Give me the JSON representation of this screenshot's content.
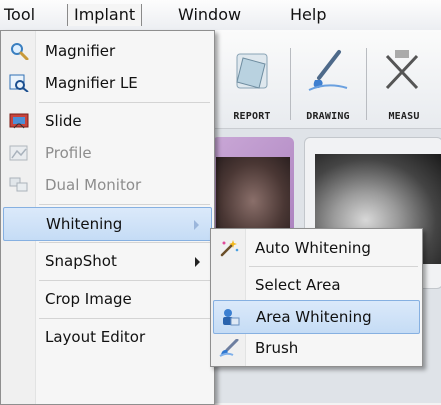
{
  "menubar": {
    "items": [
      "Tool",
      "Implant",
      "Window",
      "Help"
    ]
  },
  "toolbar": {
    "buttons": [
      "REPORT",
      "DRAWING",
      "MEASU"
    ]
  },
  "tool_menu": {
    "items": [
      {
        "label": "Magnifier",
        "icon": "magnifier-icon"
      },
      {
        "label": "Magnifier LE",
        "icon": "magnifier-le-icon"
      },
      {
        "label": "Slide",
        "icon": "slide-icon"
      },
      {
        "label": "Profile",
        "icon": "profile-icon",
        "disabled": true
      },
      {
        "label": "Dual Monitor",
        "icon": "dual-monitor-icon",
        "disabled": true
      },
      {
        "label": "Whitening",
        "submenu": true,
        "highlighted": true
      },
      {
        "label": "SnapShot",
        "submenu": true
      },
      {
        "label": "Crop Image"
      },
      {
        "label": "Layout Editor"
      }
    ]
  },
  "whitening_submenu": {
    "items": [
      {
        "label": "Auto Whitening",
        "icon": "magic-wand-icon"
      },
      {
        "label": "Select Area"
      },
      {
        "label": "Area Whitening",
        "icon": "area-whitening-icon",
        "highlighted": true
      },
      {
        "label": "Brush",
        "icon": "brush-icon"
      }
    ]
  },
  "colors": {
    "highlight": "#c5dcf5",
    "highlight_border": "#86b0e1",
    "disabled_text": "#8d8d8d"
  }
}
